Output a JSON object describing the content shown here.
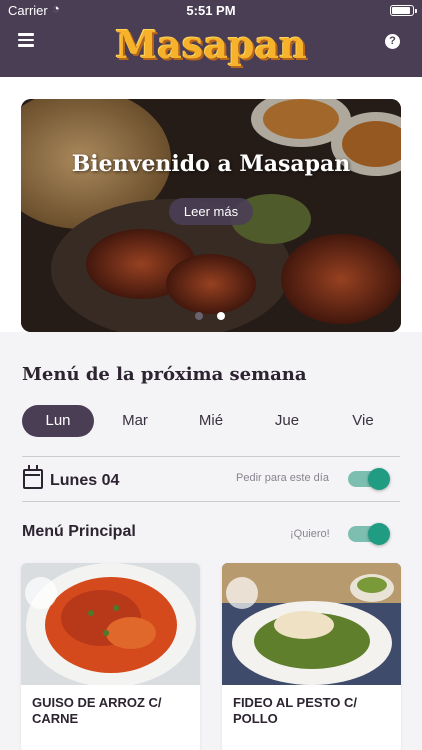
{
  "status": {
    "carrier": "Carrier",
    "time": "5:51 PM"
  },
  "header": {
    "logo": "Masapan",
    "help": "?"
  },
  "hero": {
    "title": "Bienvenido a Masapan",
    "button": "Leer más"
  },
  "section_title": "Menú de la próxima semana",
  "days": [
    {
      "label": "Lun",
      "active": true
    },
    {
      "label": "Mar",
      "active": false
    },
    {
      "label": "Mié",
      "active": false
    },
    {
      "label": "Jue",
      "active": false
    },
    {
      "label": "Vie",
      "active": false
    }
  ],
  "day_detail": {
    "label": "Lunes 04",
    "order_label": "Pedir para este día",
    "order_on": true
  },
  "main_menu": {
    "label": "Menú Principal",
    "want_label": "¡Quiero!",
    "want_on": true
  },
  "dishes": [
    {
      "name": "GUISO DE ARROZ C/ CARNE"
    },
    {
      "name": "FIDEO AL PESTO C/ POLLO"
    }
  ],
  "colors": {
    "brand": "#4a3e55",
    "accent": "#1f9c82",
    "logo": "#f6b22a"
  }
}
